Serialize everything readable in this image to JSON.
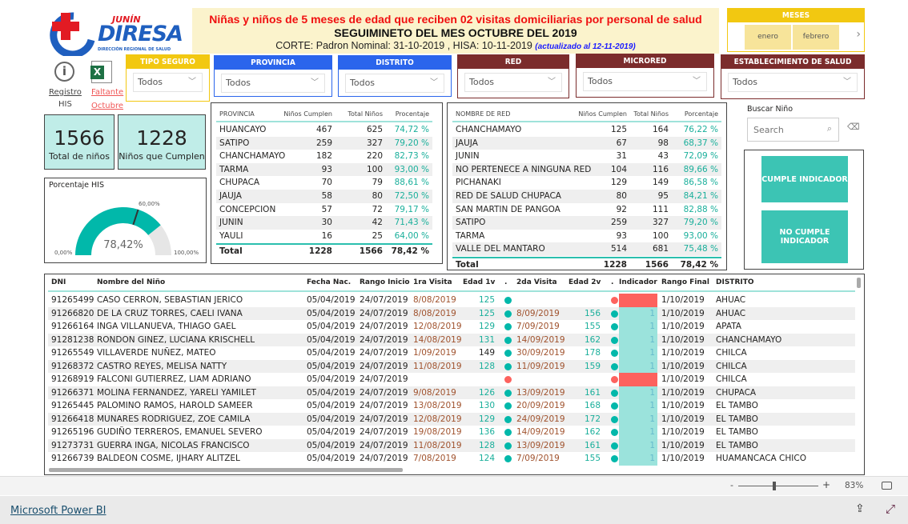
{
  "logo": {
    "brand": "DIRESA",
    "region": "JUNÍN",
    "subtitle": "DIRECCIÓN REGIONAL DE SALUD"
  },
  "banner": {
    "line1": "Niñas y niños de 5 meses de edad que reciben 02 visitas domiciliarias por personal de salud",
    "line2": "SEGUIMINETO DEL MES OCTUBRE DEL 2019",
    "line3": "CORTE: Padron Nominal: 31-10-2019 ,  HISA: 10-11-2019",
    "updated": "(actualizado al 12-11-2019)"
  },
  "meses": {
    "title": "MESES",
    "items": [
      "enero",
      "febrero"
    ]
  },
  "links": {
    "registro": "Registro",
    "his": "HIS",
    "faltante": "Faltante",
    "octubre": "Octubre"
  },
  "slicers": {
    "tipo_seguro": {
      "title": "TIPO SEGURO",
      "value": "Todos"
    },
    "provincia": {
      "title": "PROVINCIA",
      "value": "Todos"
    },
    "distrito": {
      "title": "DISTRITO",
      "value": "Todos"
    },
    "red": {
      "title": "RED",
      "value": "Todos"
    },
    "microred": {
      "title": "MICRORED",
      "value": "Todos"
    },
    "establecimiento": {
      "title": "ESTABLECIMIENTO DE SALUD",
      "value": "Todos"
    }
  },
  "colors": {
    "yellow": "#f2c811",
    "blue": "#2b65ec",
    "maroon": "#7b2c2c",
    "teal": "#01b8aa",
    "red": "#fd625e",
    "light_teal": "#c0ede8"
  },
  "kpis": {
    "total": {
      "value": "1566",
      "label": "Total de niños"
    },
    "cumplen": {
      "value": "1228",
      "label": "Niños que Cumplen"
    }
  },
  "gauge": {
    "title": "Porcentaje HIS",
    "value": 78.42,
    "value_label": "78,42%",
    "min_label": "0,00%",
    "max_label": "100,00%",
    "target": 60,
    "target_label": "60,00%"
  },
  "prov_table": {
    "headers": [
      "PROVINCIA",
      "Niños Cumplen",
      "Total Niños",
      "Procentaje"
    ],
    "rows": [
      [
        "HUANCAYO",
        "467",
        "625",
        "74,72 %"
      ],
      [
        "SATIPO",
        "259",
        "327",
        "79,20 %"
      ],
      [
        "CHANCHAMAYO",
        "182",
        "220",
        "82,73 %"
      ],
      [
        "TARMA",
        "93",
        "100",
        "93,00 %"
      ],
      [
        "CHUPACA",
        "70",
        "79",
        "88,61 %"
      ],
      [
        "JAUJA",
        "58",
        "80",
        "72,50 %"
      ],
      [
        "CONCEPCION",
        "57",
        "72",
        "79,17 %"
      ],
      [
        "JUNIN",
        "30",
        "42",
        "71,43 %"
      ],
      [
        "YAULI",
        "16",
        "25",
        "64,00 %"
      ]
    ],
    "total": [
      "Total",
      "1228",
      "1566",
      "78,42 %"
    ]
  },
  "red_table": {
    "headers": [
      "NOMBRE DE RED",
      "Niños Cumplen",
      "Total Niños",
      "Porcentaje"
    ],
    "rows": [
      [
        "CHANCHAMAYO",
        "125",
        "164",
        "76,22 %"
      ],
      [
        "JAUJA",
        "67",
        "98",
        "68,37 %"
      ],
      [
        "JUNIN",
        "31",
        "43",
        "72,09 %"
      ],
      [
        "NO PERTENECE A NINGUNA RED",
        "104",
        "116",
        "89,66 %"
      ],
      [
        "PICHANAKI",
        "129",
        "149",
        "86,58 %"
      ],
      [
        "RED DE SALUD CHUPACA",
        "80",
        "95",
        "84,21 %"
      ],
      [
        "SAN MARTIN DE PANGOA",
        "92",
        "111",
        "82,88 %"
      ],
      [
        "SATIPO",
        "259",
        "327",
        "79,20 %"
      ],
      [
        "TARMA",
        "93",
        "100",
        "93,00 %"
      ],
      [
        "VALLE DEL MANTARO",
        "514",
        "681",
        "75,48 %"
      ]
    ],
    "total": [
      "Total",
      "1228",
      "1566",
      "78,42 %"
    ]
  },
  "search": {
    "label": "Buscar Niño",
    "placeholder": "Search"
  },
  "buttons": {
    "cumple": "CUMPLE INDICADOR",
    "no_cumple": "NO CUMPLE INDICADOR"
  },
  "main_table": {
    "headers": [
      "DNI",
      "Nombre del Niño",
      "Fecha Nac.",
      "Rango Inicio",
      "1ra Visita",
      "Edad 1v",
      ".",
      "2da Visita",
      "Edad 2v",
      ".",
      "Indicador",
      "Rango Final",
      "DISTRITO"
    ],
    "rows": [
      [
        "91265499",
        "CASO CERRON, SEBASTIAN JERICO",
        "05/04/2019",
        "24/07/2019",
        "8/08/2019",
        "125",
        "ok",
        "",
        "",
        "fail",
        "",
        "1/10/2019",
        "AHUAC"
      ],
      [
        "91266820",
        "DE LA CRUZ TORRES, CAELI IVANA",
        "05/04/2019",
        "24/07/2019",
        "8/08/2019",
        "125",
        "ok",
        "8/09/2019",
        "156",
        "ok",
        "1",
        "1/10/2019",
        "AHUAC"
      ],
      [
        "91266164",
        "INGA VILLANUEVA, THIAGO GAEL",
        "05/04/2019",
        "24/07/2019",
        "12/08/2019",
        "129",
        "ok",
        "7/09/2019",
        "155",
        "ok",
        "1",
        "1/10/2019",
        "APATA"
      ],
      [
        "91281238",
        "RONDON GINEZ, LUCIANA KRISCHELL",
        "05/04/2019",
        "24/07/2019",
        "14/08/2019",
        "131",
        "ok",
        "14/09/2019",
        "162",
        "ok",
        "1",
        "1/10/2019",
        "CHANCHAMAYO"
      ],
      [
        "91265549",
        "VILLAVERDE NUÑEZ, MATEO",
        "05/04/2019",
        "24/07/2019",
        "1/09/2019",
        "149",
        "ok",
        "30/09/2019",
        "178",
        "ok",
        "1",
        "1/10/2019",
        "CHILCA"
      ],
      [
        "91268372",
        "CASTRO REYES, MELISA NATTY",
        "05/04/2019",
        "24/07/2019",
        "11/08/2019",
        "128",
        "ok",
        "11/09/2019",
        "159",
        "ok",
        "1",
        "1/10/2019",
        "CHILCA"
      ],
      [
        "91268919",
        "FALCONI GUTIERREZ, LIAM ADRIANO",
        "05/04/2019",
        "24/07/2019",
        "",
        "",
        "fail",
        "",
        "",
        "fail",
        "",
        "1/10/2019",
        "CHILCA"
      ],
      [
        "91266371",
        "MOLINA FERNANDEZ, YARELI YAMILET",
        "05/04/2019",
        "24/07/2019",
        "9/08/2019",
        "126",
        "ok",
        "13/09/2019",
        "161",
        "ok",
        "1",
        "1/10/2019",
        "CHUPACA"
      ],
      [
        "91265445",
        "PALOMINO RAMOS, HAROLD SAMEER",
        "05/04/2019",
        "24/07/2019",
        "13/08/2019",
        "130",
        "ok",
        "20/09/2019",
        "168",
        "ok",
        "1",
        "1/10/2019",
        "EL TAMBO"
      ],
      [
        "91266418",
        "MUNARES RODRIGUEZ, ZOE CAMILA",
        "05/04/2019",
        "24/07/2019",
        "12/08/2019",
        "129",
        "ok",
        "24/09/2019",
        "172",
        "ok",
        "1",
        "1/10/2019",
        "EL TAMBO"
      ],
      [
        "91265196",
        "GUDIÑO TERREROS, EMANUEL SEVERO",
        "05/04/2019",
        "24/07/2019",
        "19/08/2019",
        "136",
        "ok",
        "14/09/2019",
        "162",
        "ok",
        "1",
        "1/10/2019",
        "EL TAMBO"
      ],
      [
        "91273731",
        "GUERRA INGA, NICOLAS FRANCISCO",
        "05/04/2019",
        "24/07/2019",
        "11/08/2019",
        "128",
        "ok",
        "13/09/2019",
        "161",
        "ok",
        "1",
        "1/10/2019",
        "EL TAMBO"
      ],
      [
        "91266739",
        "BALDEON COSME, IJHARY ALITZEL",
        "05/04/2019",
        "24/07/2019",
        "7/08/2019",
        "124",
        "ok",
        "7/09/2019",
        "155",
        "ok",
        "1",
        "1/10/2019",
        "HUAMANCACA CHICO"
      ]
    ]
  },
  "zoom": {
    "minus": "-",
    "plus": "+",
    "level": "83%",
    "slider_percent": 43
  },
  "footer": {
    "link": "Microsoft Power BI"
  }
}
